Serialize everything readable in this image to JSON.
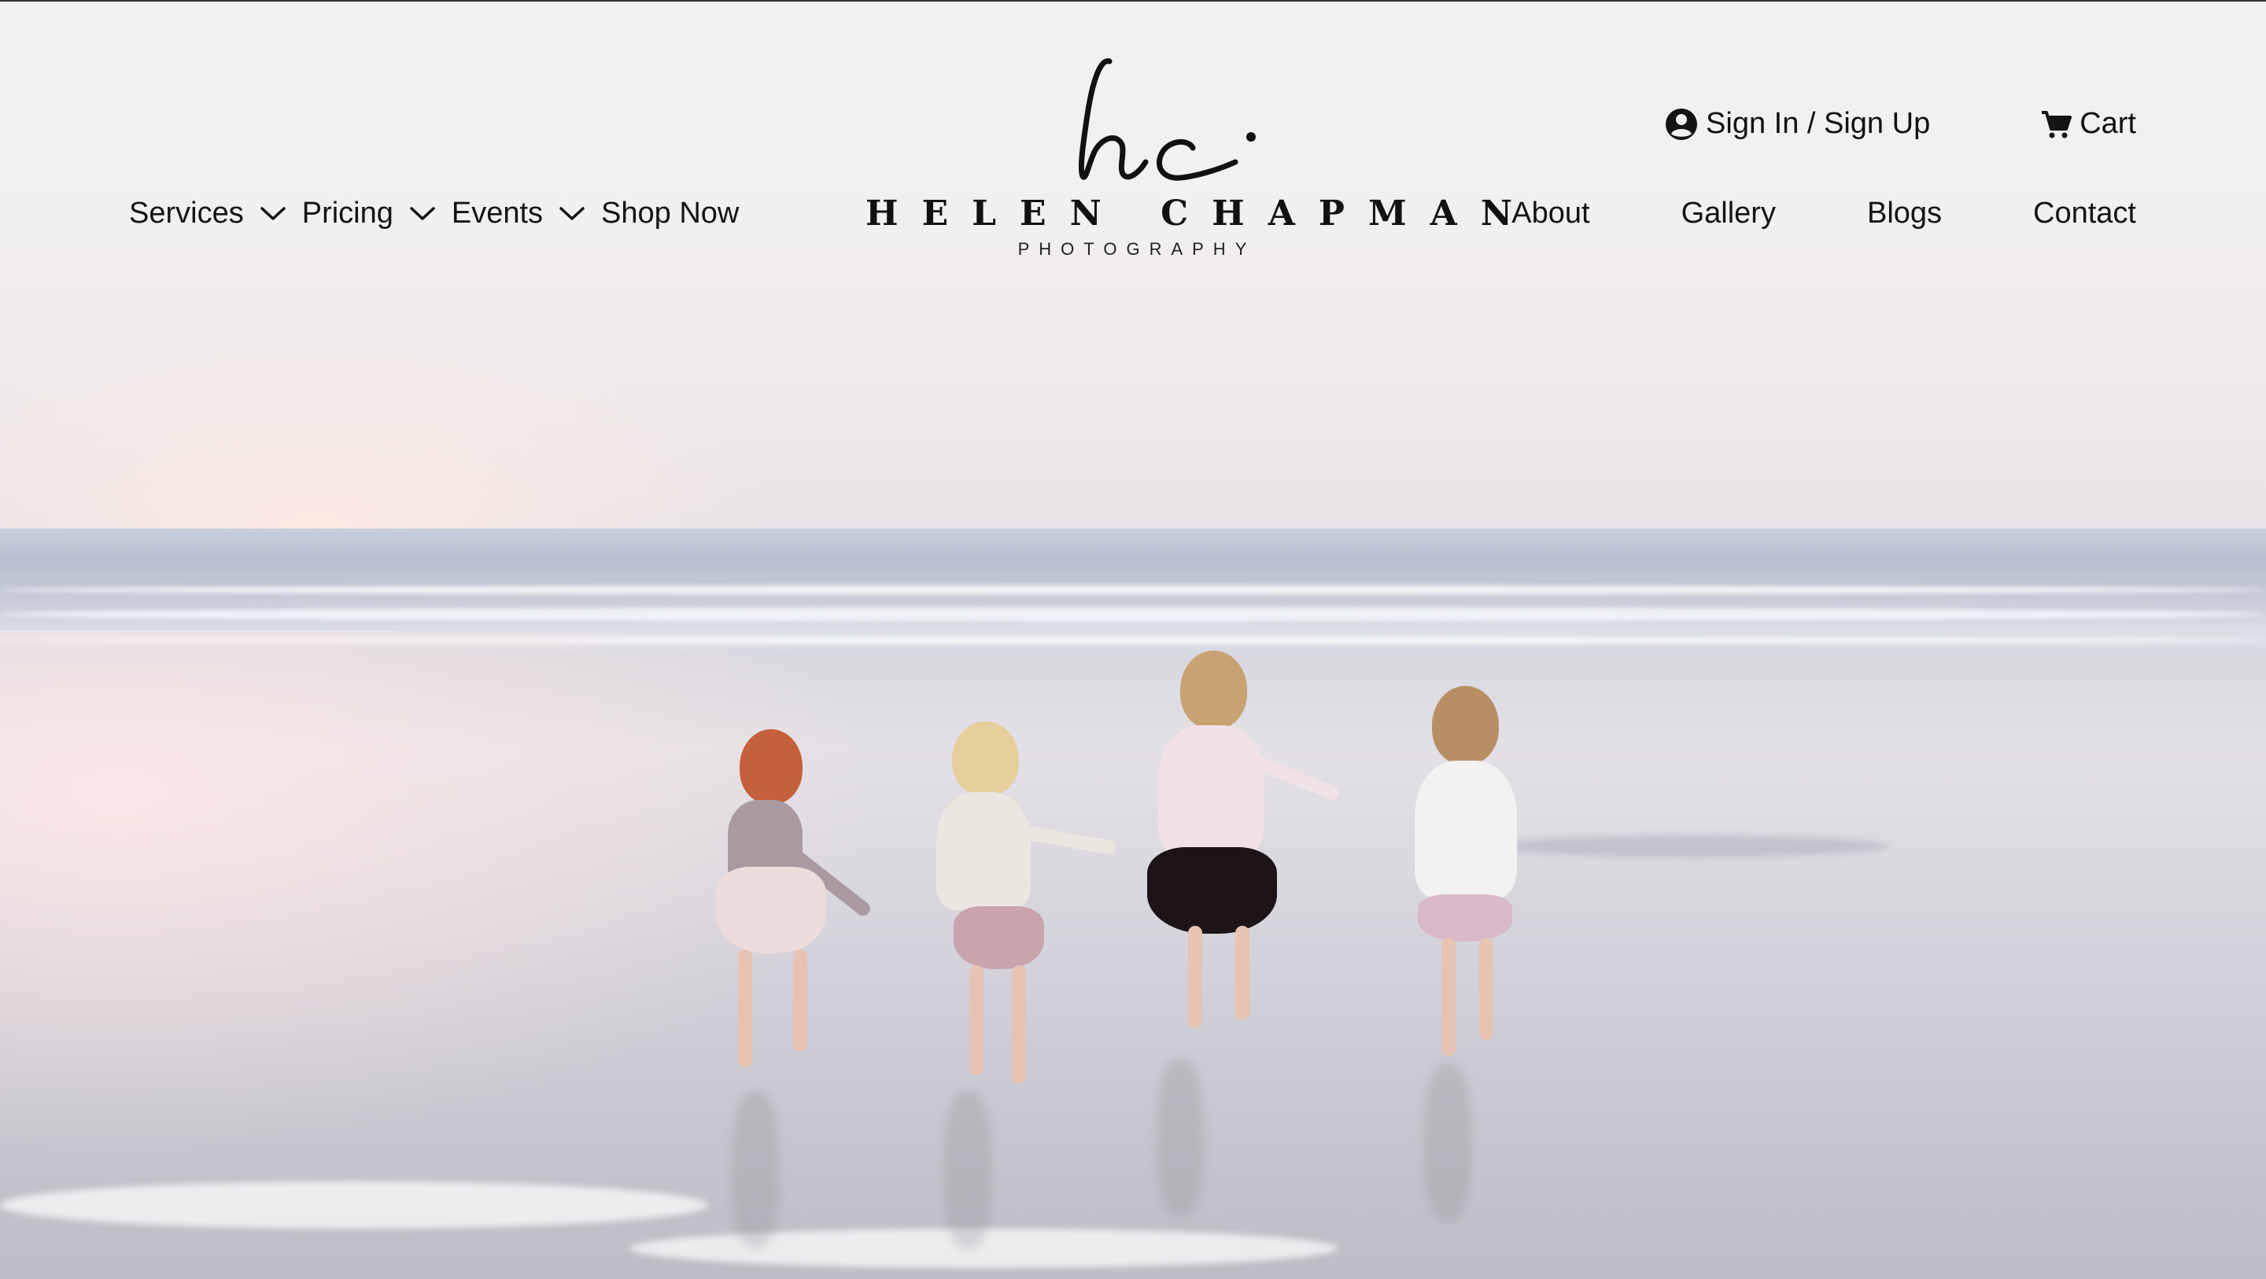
{
  "brand": {
    "monogram": "hc",
    "name": "HELEN CHAPMAN",
    "tagline": "PHOTOGRAPHY"
  },
  "nav_left": [
    {
      "label": "Services",
      "dropdown": true
    },
    {
      "label": "Pricing",
      "dropdown": true
    },
    {
      "label": "Events",
      "dropdown": true
    },
    {
      "label": "Shop Now",
      "dropdown": false
    }
  ],
  "nav_right": [
    {
      "label": "About"
    },
    {
      "label": "Gallery"
    },
    {
      "label": "Blogs"
    },
    {
      "label": "Contact"
    }
  ],
  "utility": {
    "account": {
      "label": "Sign In / Sign Up",
      "icon": "user-circle-icon"
    },
    "cart": {
      "label": "Cart",
      "icon": "cart-icon"
    }
  },
  "hero": {
    "scene": "beach-photo"
  },
  "colors": {
    "text": "#141414",
    "sky": "#f2efef",
    "sea": "#b6bfcf",
    "sand": "#d4d2da"
  }
}
